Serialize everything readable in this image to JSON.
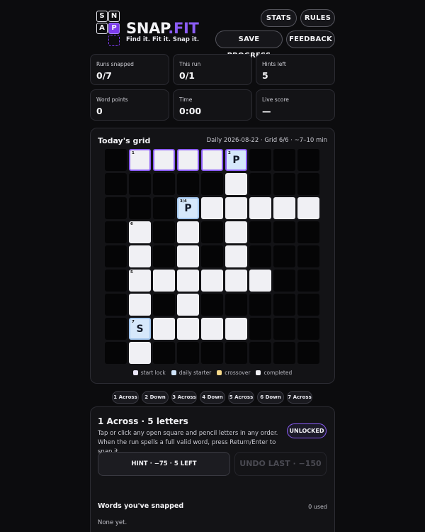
{
  "header": {
    "logo_tiles": [
      "S",
      "N",
      "A",
      "P"
    ],
    "logo_word": "SNAP",
    "logo_word_accent": ".FIT",
    "tagline": "Find it. Fit it. Snap it.",
    "buttons": {
      "stats": "STATS",
      "rules": "RULES",
      "save": "SAVE PROGRESS",
      "feedback": "FEEDBACK"
    }
  },
  "stats": [
    {
      "label": "Runs snapped",
      "value": "0/7"
    },
    {
      "label": "This run",
      "value": "0/1"
    },
    {
      "label": "Hints left",
      "value": "5"
    },
    {
      "label": "Word points",
      "value": "0"
    },
    {
      "label": "Time",
      "value": "0:00"
    },
    {
      "label": "Live score",
      "value": "—"
    }
  ],
  "grid": {
    "title": "Today's grid",
    "meta": "Daily 2026-08-22 · Grid 6/6 · ~7–10 min",
    "size": 9,
    "cells": [
      {
        "r": 0,
        "c": 1,
        "num": "1",
        "lock": true
      },
      {
        "r": 0,
        "c": 2,
        "lock": true
      },
      {
        "r": 0,
        "c": 3,
        "lock": true
      },
      {
        "r": 0,
        "c": 4,
        "lock": true
      },
      {
        "r": 0,
        "c": 5,
        "num": "2",
        "letter": "P",
        "lock": true,
        "start": true
      },
      {
        "r": 1,
        "c": 5
      },
      {
        "r": 2,
        "c": 3,
        "num": "3/4",
        "letter": "P",
        "start": true
      },
      {
        "r": 2,
        "c": 4
      },
      {
        "r": 2,
        "c": 5
      },
      {
        "r": 2,
        "c": 6
      },
      {
        "r": 2,
        "c": 7
      },
      {
        "r": 2,
        "c": 8
      },
      {
        "r": 3,
        "c": 1,
        "num": "6"
      },
      {
        "r": 3,
        "c": 3
      },
      {
        "r": 3,
        "c": 5
      },
      {
        "r": 4,
        "c": 1
      },
      {
        "r": 4,
        "c": 3
      },
      {
        "r": 4,
        "c": 5
      },
      {
        "r": 5,
        "c": 1,
        "num": "5"
      },
      {
        "r": 5,
        "c": 2
      },
      {
        "r": 5,
        "c": 3
      },
      {
        "r": 5,
        "c": 4
      },
      {
        "r": 5,
        "c": 5
      },
      {
        "r": 5,
        "c": 6
      },
      {
        "r": 6,
        "c": 1
      },
      {
        "r": 6,
        "c": 3
      },
      {
        "r": 7,
        "c": 1,
        "num": "7",
        "letter": "S",
        "start": true
      },
      {
        "r": 7,
        "c": 2
      },
      {
        "r": 7,
        "c": 3
      },
      {
        "r": 7,
        "c": 4
      },
      {
        "r": 7,
        "c": 5
      },
      {
        "r": 8,
        "c": 1
      }
    ]
  },
  "legend": [
    {
      "label": "start lock",
      "color": "#e9e6f7"
    },
    {
      "label": "daily starter",
      "color": "#cfe4fa"
    },
    {
      "label": "crossover",
      "color": "#f7d98a"
    },
    {
      "label": "completed",
      "color": "#f0f0f4"
    }
  ],
  "clues": [
    "1 Across",
    "2 Down",
    "3 Across",
    "4 Down",
    "5 Across",
    "6 Down",
    "7 Across"
  ],
  "active_clue": {
    "title": "1 Across · 5 letters",
    "description": "Tap or click any open square and pencil letters in any order. When the run spells a full valid word, press Return/Enter to snap it.",
    "status": "UNLOCKED",
    "hint_label": "HINT · −75 · 5 LEFT",
    "undo_label": "UNDO LAST · −150"
  },
  "snapped": {
    "title": "Words you've snapped",
    "used": "0 used",
    "empty": "None yet."
  }
}
